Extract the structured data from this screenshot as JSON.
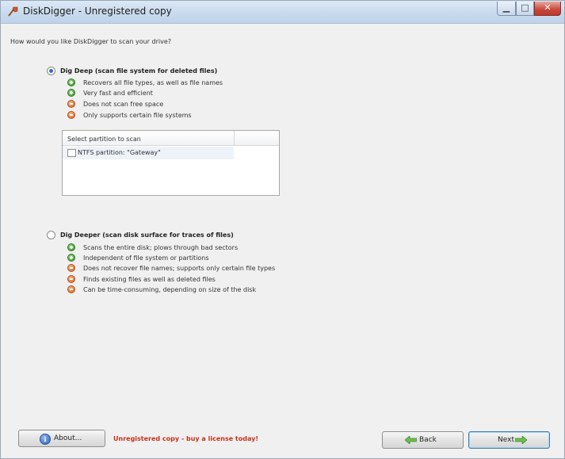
{
  "window": {
    "title": "DiskDigger - Unregistered copy"
  },
  "question": "How would you like DiskDigger to scan your drive?",
  "dig_deep": {
    "label": "Dig Deep (scan file system for deleted files)",
    "selected": true,
    "features": [
      {
        "text": "Recovers all file types, as well as file names",
        "type": "pro"
      },
      {
        "text": "Very fast and efficient",
        "type": "pro"
      },
      {
        "text": "Does not scan free space",
        "type": "con"
      },
      {
        "text": "Only supports certain file systems",
        "type": "con"
      }
    ]
  },
  "partitions": {
    "header": "Select partition to scan",
    "items": [
      {
        "label": "NTFS partition: \"Gateway\"",
        "checked": false
      }
    ]
  },
  "dig_deeper": {
    "label": "Dig Deeper (scan disk surface for traces of files)",
    "selected": false,
    "features": [
      {
        "text": "Scans the entire disk; plows through bad sectors",
        "type": "pro"
      },
      {
        "text": "Independent of file system or partitions",
        "type": "pro"
      },
      {
        "text": "Does not recover file names; supports only certain file types",
        "type": "con"
      },
      {
        "text": "Finds existing files as well as deleted files",
        "type": "con"
      },
      {
        "text": "Can be time-consuming, depending on size of the disk",
        "type": "con"
      }
    ]
  },
  "footer": {
    "about_label": "About...",
    "unregistered_text": "Unregistered copy - buy a license today!",
    "back_label": "Back",
    "next_label": "Next"
  },
  "colors": {
    "pro": "#3c9b2e",
    "con": "#d9672a",
    "warning_text": "#c4321c",
    "accent": "#2d70c6"
  }
}
